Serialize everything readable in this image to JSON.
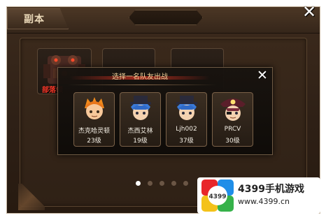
{
  "screen": {
    "title": "副本"
  },
  "dungeons": [
    {
      "label": "部落领"
    }
  ],
  "pager": {
    "count": 5,
    "active_index": 0
  },
  "modal": {
    "title": "选择一名队友出战",
    "close": "✕"
  },
  "friends": [
    {
      "name": "杰克哈灵顿",
      "level": "23级",
      "avatar_icon": "orange-hair-hero-avatar-icon"
    },
    {
      "name": "杰西艾林",
      "level": "19级",
      "avatar_icon": "blue-hair-hat-hero-avatar-icon"
    },
    {
      "name": "Ljh002",
      "level": "37级",
      "avatar_icon": "blue-hair-hat-hero-avatar-icon"
    },
    {
      "name": "PRCV",
      "level": "30级",
      "avatar_icon": "pirate-hat-hero-avatar-icon"
    }
  ],
  "outer_close": "✕",
  "watermark": {
    "logo_text": "4399",
    "title": "4399手机游戏",
    "url": "www.4399.cn"
  },
  "colors": {
    "panel_bg": "#2e2016",
    "dungeon_label": "#ff3a2a",
    "modal_title": "#f2d29a",
    "title_glow": "#a52a1d"
  }
}
